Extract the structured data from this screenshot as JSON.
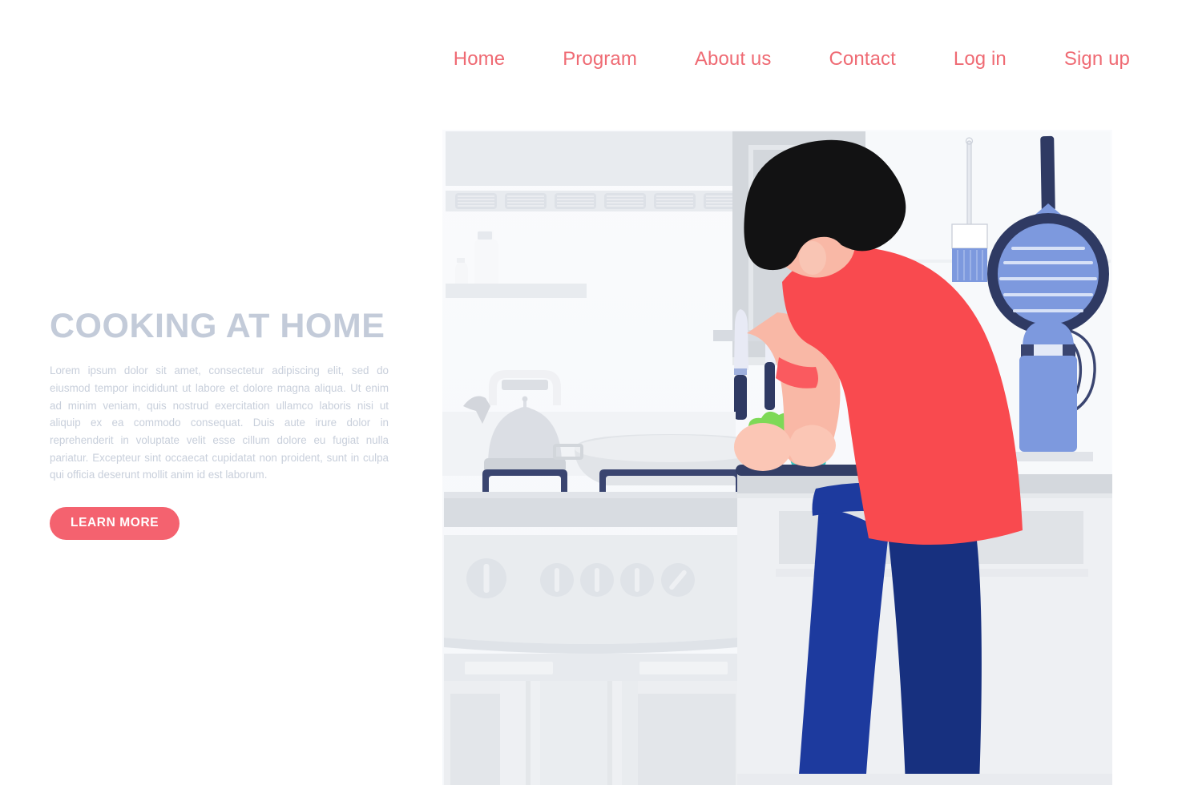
{
  "nav": {
    "items": [
      {
        "label": "Home",
        "name": "nav-link-home"
      },
      {
        "label": "Program",
        "name": "nav-link-program"
      },
      {
        "label": "About us",
        "name": "nav-link-about-us"
      },
      {
        "label": "Contact",
        "name": "nav-link-contact"
      },
      {
        "label": "Log in",
        "name": "nav-link-log-in"
      },
      {
        "label": "Sign up",
        "name": "nav-link-sign-up"
      }
    ],
    "link_color": "#ef6a73"
  },
  "hero": {
    "title": "COOKING AT HOME",
    "title_color": "#c3cbd9",
    "body": "Lorem ipsum dolor sit amet, consectetur adipiscing elit, sed do eiusmod tempor incididunt ut labore et dolore magna aliqua. Ut enim ad minim veniam, quis nostrud exercitation ullamco laboris nisi ut aliquip ex ea commodo consequat. Duis aute irure dolor in reprehenderit in voluptate velit esse cillum dolore eu fugiat nulla pariatur. Excepteur sint occaecat cupidatat non proident, sunt in culpa qui officia deserunt mollit anim id est laborum.",
    "body_color": "#c8cfdb",
    "cta_label": "LEARN MORE",
    "cta_color": "#f4626f"
  },
  "illustration": {
    "alt": "Flat illustration of a man cooking in a kitchen, chopping vegetables on a cutting board",
    "colors": {
      "shirt_red": "#f94a4f",
      "pants_navy": "#1d3a9e",
      "pants_navy_dark": "#17307f",
      "hair_black": "#121213",
      "skin": "#f9b8a6",
      "skin_light": "#fbc6b5",
      "utensil_blue": "#6d8bd9",
      "utensil_navy": "#3a4570",
      "cabinet_gray": "#e7eaee",
      "wall_white": "#f7f9fb",
      "counter_gray": "#d4d8dd",
      "lettuce_green": "#7ed957",
      "cabbage_teal": "#36c7c0"
    },
    "elements": [
      "upper-cabinets",
      "slatted-cabinet-doors",
      "wall-shelf",
      "spice-bottles",
      "range-hood-cabinet",
      "teapot",
      "frying-pan",
      "gas-stove",
      "stove-knobs",
      "oven-door",
      "knife-rack",
      "chef-knife",
      "paring-knife",
      "cutting-board",
      "lettuce",
      "cabbage",
      "cook-figure",
      "hanging-brush",
      "grill-pan",
      "whisk",
      "utensil-holder",
      "countertop"
    ]
  }
}
